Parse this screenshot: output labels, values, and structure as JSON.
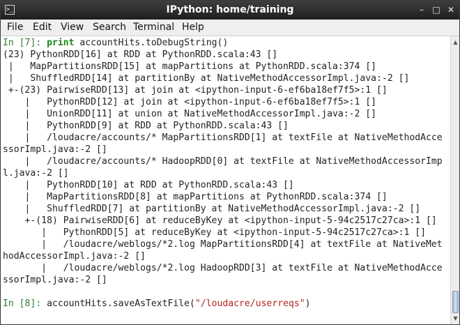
{
  "window": {
    "title": "IPython: home/training",
    "icon": "terminal-icon",
    "controls": {
      "minimize": "–",
      "maximize": "□",
      "close": "✕"
    }
  },
  "menu": [
    "File",
    "Edit",
    "View",
    "Search",
    "Terminal",
    "Help"
  ],
  "terminal": {
    "in7": {
      "prompt": "In [",
      "num": "7",
      "close": "]: ",
      "keyword": "print",
      "code": " accountHits.toDebugString()"
    },
    "output": [
      "(23) PythonRDD[16] at RDD at PythonRDD.scala:43 []",
      " |   MapPartitionsRDD[15] at mapPartitions at PythonRDD.scala:374 []",
      " |   ShuffledRDD[14] at partitionBy at NativeMethodAccessorImpl.java:-2 []",
      " +-(23) PairwiseRDD[13] at join at <ipython-input-6-ef6ba18ef7f5>:1 []",
      "    |   PythonRDD[12] at join at <ipython-input-6-ef6ba18ef7f5>:1 []",
      "    |   UnionRDD[11] at union at NativeMethodAccessorImpl.java:-2 []",
      "    |   PythonRDD[9] at RDD at PythonRDD.scala:43 []",
      "    |   /loudacre/accounts/* MapPartitionsRDD[1] at textFile at NativeMethodAcce",
      "ssorImpl.java:-2 []",
      "    |   /loudacre/accounts/* HadoopRDD[0] at textFile at NativeMethodAccessorImp",
      "l.java:-2 []",
      "    |   PythonRDD[10] at RDD at PythonRDD.scala:43 []",
      "    |   MapPartitionsRDD[8] at mapPartitions at PythonRDD.scala:374 []",
      "    |   ShuffledRDD[7] at partitionBy at NativeMethodAccessorImpl.java:-2 []",
      "    +-(18) PairwiseRDD[6] at reduceByKey at <ipython-input-5-94c2517c27ca>:1 []",
      "       |   PythonRDD[5] at reduceByKey at <ipython-input-5-94c2517c27ca>:1 []",
      "       |   /loudacre/weblogs/*2.log MapPartitionsRDD[4] at textFile at NativeMet",
      "hodAccessorImpl.java:-2 []",
      "       |   /loudacre/weblogs/*2.log HadoopRDD[3] at textFile at NativeMethodAcce",
      "ssorImpl.java:-2 []"
    ],
    "in8": {
      "prompt": "In [",
      "num": "8",
      "close": "]: ",
      "code": "accountHits.saveAsTextFile(",
      "string": "\"/loudacre/userreqs\"",
      "tail": ")"
    }
  },
  "colors": {
    "titlebar": "#2b2b2b",
    "prompt": "#2e7d32",
    "string": "#b4231f",
    "keyword": "#1b8a1b"
  }
}
